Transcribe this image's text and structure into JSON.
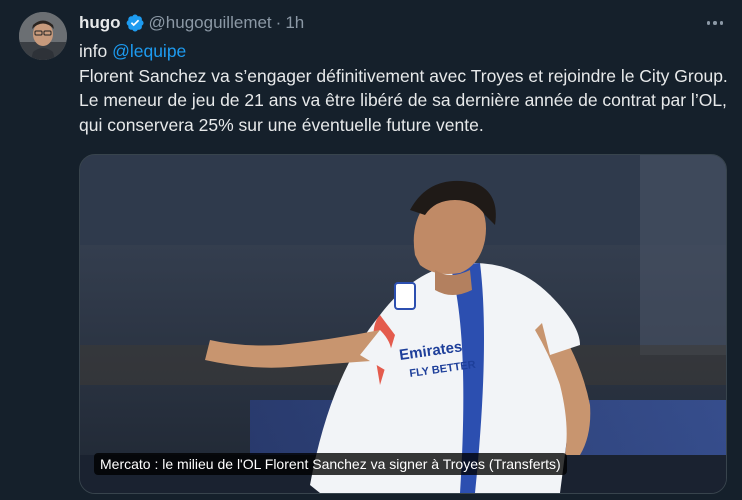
{
  "author": {
    "name": "hugo",
    "handle": "@hugoguillemet",
    "separator": "·",
    "time": "1h"
  },
  "tweet": {
    "line1_prefix": "info ",
    "mention": "@lequipe",
    "text": "Florent Sanchez va s’engager définitivement avec Troyes et rejoindre le City Group. Le meneur de jeu de 21 ans va être libéré de sa dernière année de contrat par l’OL, qui conservera 25% sur une éventuelle future vente."
  },
  "media": {
    "caption": "Mercato : le milieu de l'OL Florent Sanchez va signer à Troyes (Transferts)"
  },
  "icons": {
    "verified": "verified-badge-icon",
    "more": "more-options-icon"
  },
  "colors": {
    "background": "#15202b",
    "accent": "#1d9bf0",
    "secondary_text": "#8b98a5",
    "primary_text": "#e7e9ea"
  }
}
